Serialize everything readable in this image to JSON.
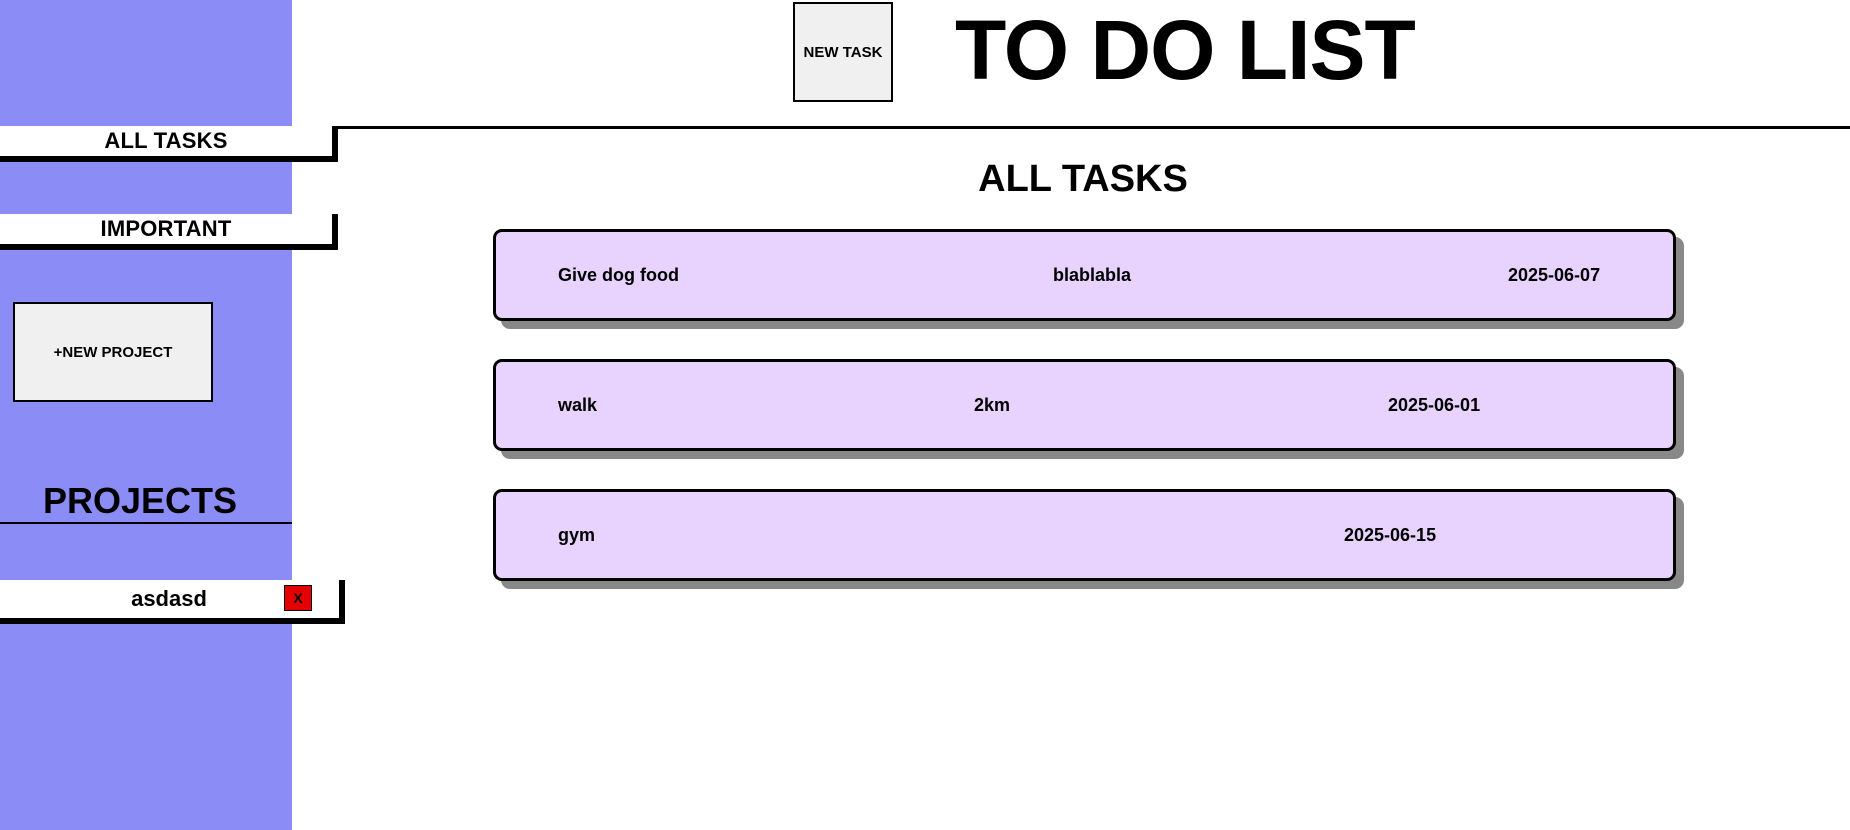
{
  "app": {
    "title": "TO DO LIST",
    "new_task_label": "NEW TASK"
  },
  "sidebar": {
    "nav": [
      {
        "label": "ALL TASKS"
      },
      {
        "label": "IMPORTANT"
      }
    ],
    "new_project_label": "+NEW PROJECT",
    "projects_heading": "PROJECTS",
    "projects": [
      {
        "name": "asdasd",
        "delete_label": "X"
      }
    ]
  },
  "main": {
    "section_title": "ALL TASKS",
    "tasks": [
      {
        "title": "Give dog food",
        "description": "blablabla",
        "due": "2025-06-07"
      },
      {
        "title": "walk",
        "description": "2km",
        "due": "2025-06-01"
      },
      {
        "title": "gym",
        "description": "",
        "due": "2025-06-15"
      }
    ]
  },
  "colors": {
    "sidebar_bg": "#8b8cf5",
    "task_bg": "#e8d3fe",
    "delete_bg": "#e40000",
    "button_bg": "#f0f0f0"
  }
}
